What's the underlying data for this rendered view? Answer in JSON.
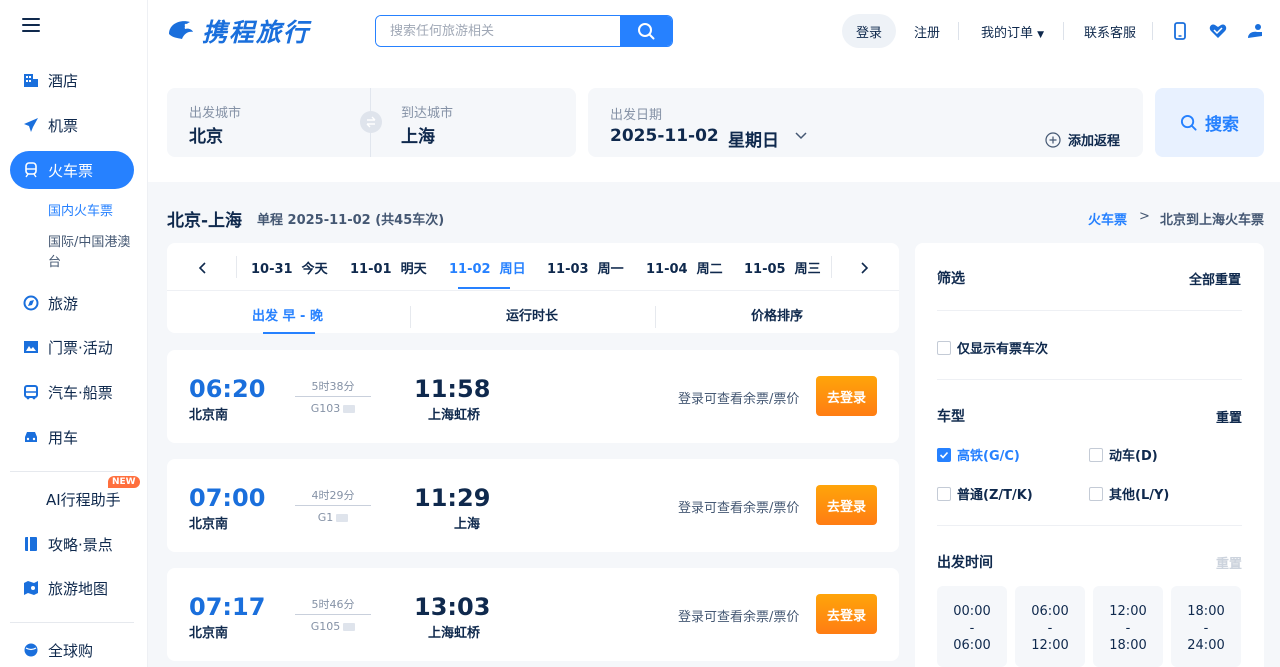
{
  "brand": {
    "name": "携程旅行"
  },
  "search": {
    "placeholder": "搜索任何旅游相关"
  },
  "header": {
    "login": "登录",
    "register": "注册",
    "my_orders": "我的订单",
    "service": "联系客服"
  },
  "sidebar": {
    "items": [
      {
        "label": "酒店",
        "icon": "hotel-icon"
      },
      {
        "label": "机票",
        "icon": "plane-icon"
      },
      {
        "label": "火车票",
        "icon": "train-icon",
        "active": true
      },
      {
        "label": "旅游",
        "icon": "travel-icon"
      },
      {
        "label": "门票·活动",
        "icon": "ticket-icon"
      },
      {
        "label": "汽车·船票",
        "icon": "bus-icon"
      },
      {
        "label": "用车",
        "icon": "car-icon"
      }
    ],
    "sub_items": [
      {
        "label": "国内火车票",
        "active": true
      },
      {
        "label": "国际/中国港澳台"
      }
    ],
    "ai_assistant": "AI行程助手",
    "new_badge": "NEW",
    "guide": "攻略·景点",
    "map": "旅游地图",
    "global": "全球购"
  },
  "query": {
    "from_label": "出发城市",
    "from_value": "北京",
    "to_label": "到达城市",
    "to_value": "上海",
    "date_label": "出发日期",
    "date_value": "2025-11-02",
    "weekday": "星期日",
    "add_return": "添加返程",
    "search_button": "搜索"
  },
  "route": {
    "title": "北京-上海",
    "subtitle": "单程 2025-11-02 (共45车次)",
    "crumb_root": "火车票",
    "crumb_sep": ">",
    "crumb_current": "北京到上海火车票"
  },
  "dates": [
    {
      "date": "10-31",
      "day": "今天"
    },
    {
      "date": "11-01",
      "day": "明天"
    },
    {
      "date": "11-02",
      "day": "周日",
      "active": true
    },
    {
      "date": "11-03",
      "day": "周一"
    },
    {
      "date": "11-04",
      "day": "周二"
    },
    {
      "date": "11-05",
      "day": "周三"
    }
  ],
  "sort": {
    "departure": "出发 早 - 晚",
    "duration": "运行时长",
    "price": "价格排序"
  },
  "trains": [
    {
      "dep_time": "06:20",
      "dep_station": "北京南",
      "duration": "5时38分",
      "number": "G103",
      "arr_time": "11:58",
      "arr_station": "上海虹桥",
      "tip": "登录可查看余票/票价",
      "button": "去登录"
    },
    {
      "dep_time": "07:00",
      "dep_station": "北京南",
      "duration": "4时29分",
      "number": "G1",
      "arr_time": "11:29",
      "arr_station": "上海",
      "tip": "登录可查看余票/票价",
      "button": "去登录"
    },
    {
      "dep_time": "07:17",
      "dep_station": "北京南",
      "duration": "5时46分",
      "number": "G105",
      "arr_time": "13:03",
      "arr_station": "上海虹桥",
      "tip": "登录可查看余票/票价",
      "button": "去登录"
    }
  ],
  "filter": {
    "title": "筛选",
    "reset_all": "全部重置",
    "only_available": "仅显示有票车次",
    "type_title": "车型",
    "type_reset": "重置",
    "types": [
      {
        "label": "高铁(G/C)",
        "checked": true
      },
      {
        "label": "动车(D)",
        "checked": false
      },
      {
        "label": "普通(Z/T/K)",
        "checked": false
      },
      {
        "label": "其他(L/Y)",
        "checked": false
      }
    ],
    "time_title": "出发时间",
    "time_reset": "重置",
    "time_ranges": [
      {
        "start": "00:00",
        "sep": "-",
        "end": "06:00"
      },
      {
        "start": "06:00",
        "sep": "-",
        "end": "12:00"
      },
      {
        "start": "12:00",
        "sep": "-",
        "end": "18:00"
      },
      {
        "start": "18:00",
        "sep": "-",
        "end": "24:00"
      }
    ]
  },
  "colors": {
    "primary": "#2681ff",
    "accent_orange": "#ff7d13",
    "text": "#0f294d"
  }
}
